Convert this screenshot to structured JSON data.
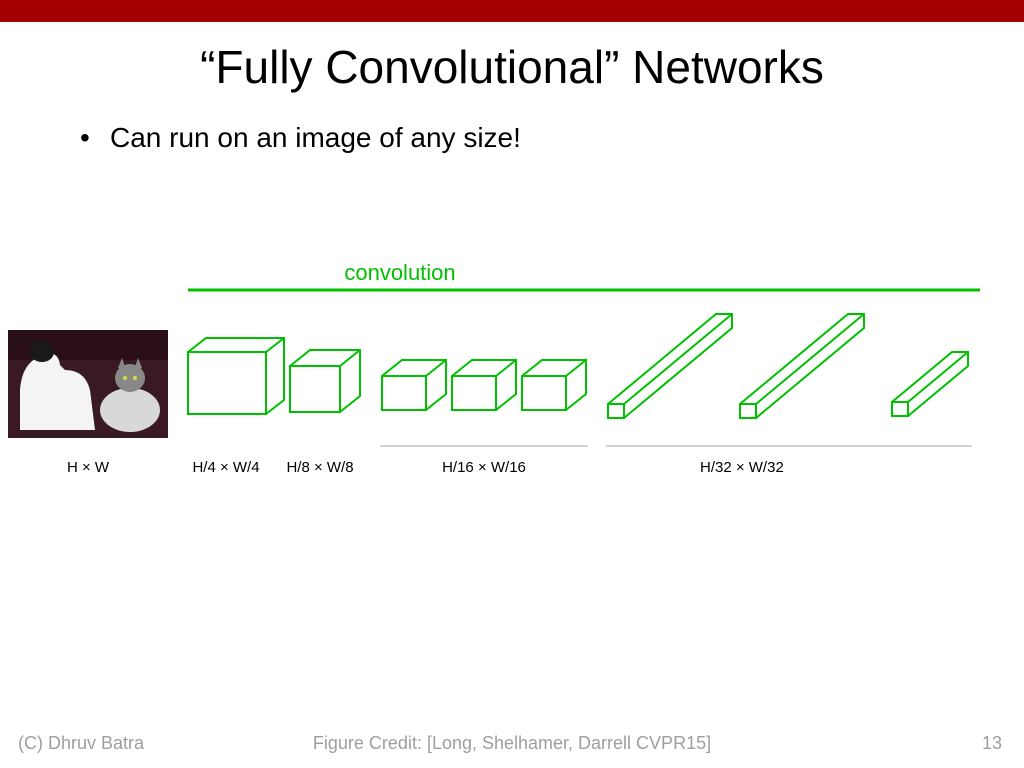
{
  "title": "“Fully Convolutional” Networks",
  "bullet1": "Can run on an image of any size!",
  "conv_label": "convolution",
  "dims": {
    "d0": "H × W",
    "d1": "H/4 × W/4",
    "d2": "H/8 × W/8",
    "d3": "H/16 × W/16",
    "d4": "H/32 × W/32"
  },
  "footer": {
    "copyright": "(C) Dhruv Batra",
    "credit": "Figure Credit: [Long, Shelhamer, Darrell CVPR15]",
    "page": "13"
  }
}
